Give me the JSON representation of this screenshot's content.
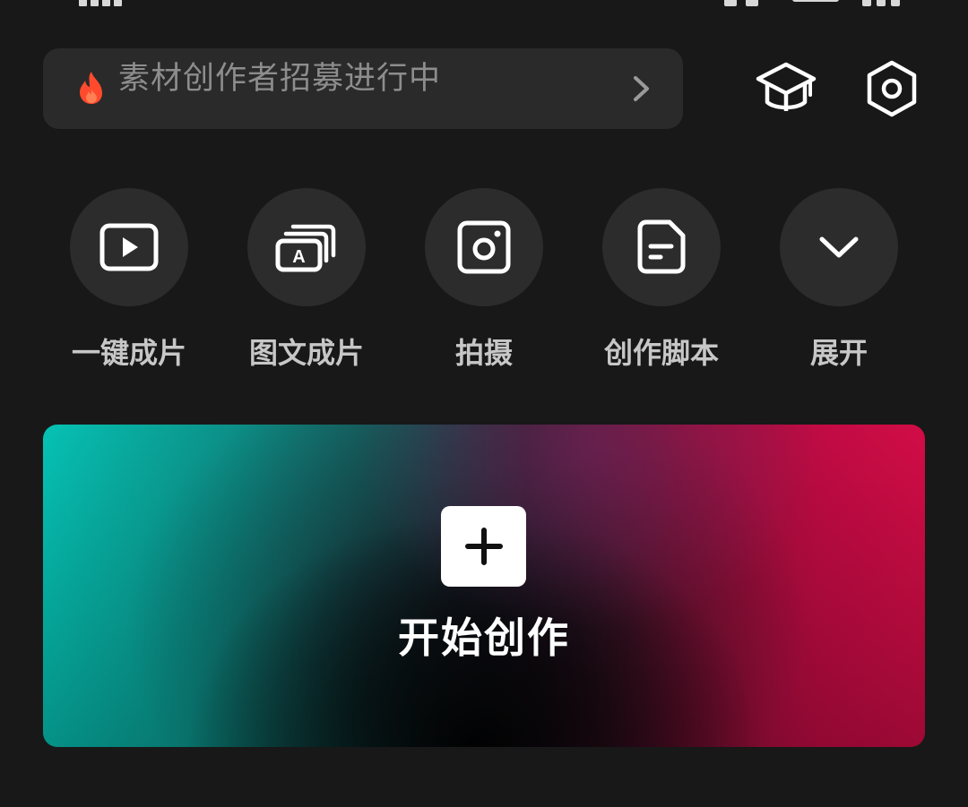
{
  "banner": {
    "text": "素材创作者招募进行中",
    "icon": "fire-icon",
    "arrow_icon": "chevron-right-icon"
  },
  "top_icons": [
    {
      "name": "graduation-cap-icon"
    },
    {
      "name": "settings-hexagon-icon"
    }
  ],
  "quick_actions": [
    {
      "label": "一键成片",
      "icon": "play-video-icon"
    },
    {
      "label": "图文成片",
      "icon": "image-text-icon"
    },
    {
      "label": "拍摄",
      "icon": "camera-icon"
    },
    {
      "label": "创作脚本",
      "icon": "script-document-icon"
    },
    {
      "label": "展开",
      "icon": "chevron-down-icon"
    }
  ],
  "hero": {
    "title": "开始创作",
    "icon": "plus-icon",
    "colors": {
      "left": "#06c2b4",
      "right": "#d20c46"
    }
  },
  "colors": {
    "background": "#181818",
    "surface": "#2a2a2a",
    "label_text": "#c7c7c7",
    "banner_text": "#8d8d8d",
    "fire": "#ff4a2e"
  }
}
